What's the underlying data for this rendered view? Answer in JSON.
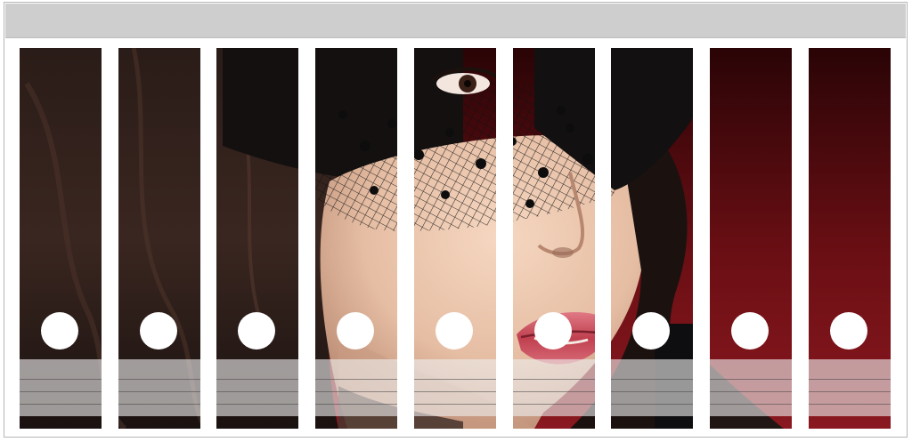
{
  "binders": [
    {
      "label": ""
    },
    {
      "label": ""
    },
    {
      "label": ""
    },
    {
      "label": ""
    },
    {
      "label": ""
    },
    {
      "label": ""
    },
    {
      "label": ""
    },
    {
      "label": ""
    },
    {
      "label": ""
    }
  ],
  "colors": {
    "background_top": "#3a0608",
    "background_bottom": "#7b1218",
    "hair": "#1b1513",
    "skin": "#e8c4ab",
    "lips": "#c94b58",
    "veil": "#151515",
    "label_panel": "#eeeeee",
    "finger_hole": "#ffffff",
    "top_bar": "#cecece"
  }
}
